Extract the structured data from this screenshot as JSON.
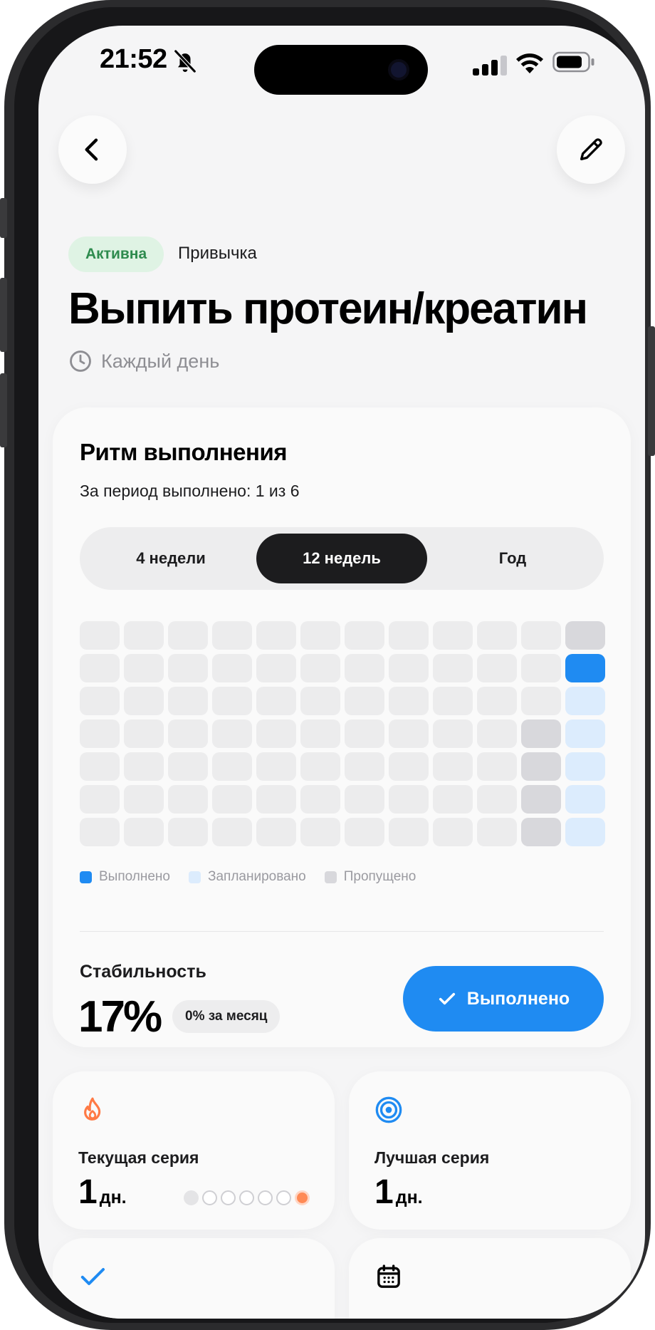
{
  "status_bar": {
    "time": "21:52"
  },
  "header": {
    "badge": "Активна",
    "type": "Привычка",
    "title": "Выпить протеин/креатин",
    "schedule": "Каждый день"
  },
  "rhythm": {
    "title": "Ритм выполнения",
    "summary": "За период выполнено: 1 из 6",
    "tabs": [
      {
        "label": "4 недели",
        "active": false
      },
      {
        "label": "12 недель",
        "active": true
      },
      {
        "label": "Год",
        "active": false
      }
    ],
    "legend": [
      {
        "label": "Выполнено",
        "color": "#1f8bf2"
      },
      {
        "label": "Запланировано",
        "color": "#dcecfd"
      },
      {
        "label": "Пропущено",
        "color": "#d8d8dc"
      }
    ]
  },
  "heatmap": {
    "weeks": 12,
    "days_per_week": 7,
    "state_colors": {
      "empty": "#ececed",
      "done": "#1f8bf2",
      "planned": "#dcecfd",
      "missed": "#d8d8dc"
    },
    "columns": [
      [
        "empty",
        "empty",
        "empty",
        "empty",
        "empty",
        "empty",
        "empty"
      ],
      [
        "empty",
        "empty",
        "empty",
        "empty",
        "empty",
        "empty",
        "empty"
      ],
      [
        "empty",
        "empty",
        "empty",
        "empty",
        "empty",
        "empty",
        "empty"
      ],
      [
        "empty",
        "empty",
        "empty",
        "empty",
        "empty",
        "empty",
        "empty"
      ],
      [
        "empty",
        "empty",
        "empty",
        "empty",
        "empty",
        "empty",
        "empty"
      ],
      [
        "empty",
        "empty",
        "empty",
        "empty",
        "empty",
        "empty",
        "empty"
      ],
      [
        "empty",
        "empty",
        "empty",
        "empty",
        "empty",
        "empty",
        "empty"
      ],
      [
        "empty",
        "empty",
        "empty",
        "empty",
        "empty",
        "empty",
        "empty"
      ],
      [
        "empty",
        "empty",
        "empty",
        "empty",
        "empty",
        "empty",
        "empty"
      ],
      [
        "empty",
        "empty",
        "empty",
        "empty",
        "empty",
        "empty",
        "empty"
      ],
      [
        "empty",
        "empty",
        "empty",
        "missed",
        "missed",
        "missed",
        "missed"
      ],
      [
        "missed",
        "done",
        "planned",
        "planned",
        "planned",
        "planned",
        "planned"
      ]
    ]
  },
  "stability": {
    "label": "Стабильность",
    "value": "17%",
    "monthly": "0% за месяц",
    "done_button": "Выполнено"
  },
  "stats": {
    "current": {
      "label": "Текущая серия",
      "value": "1",
      "unit": "дн.",
      "dots": [
        "filled",
        "empty",
        "empty",
        "empty",
        "empty",
        "empty",
        "current"
      ]
    },
    "best": {
      "label": "Лучшая серия",
      "value": "1",
      "unit": "дн."
    }
  }
}
